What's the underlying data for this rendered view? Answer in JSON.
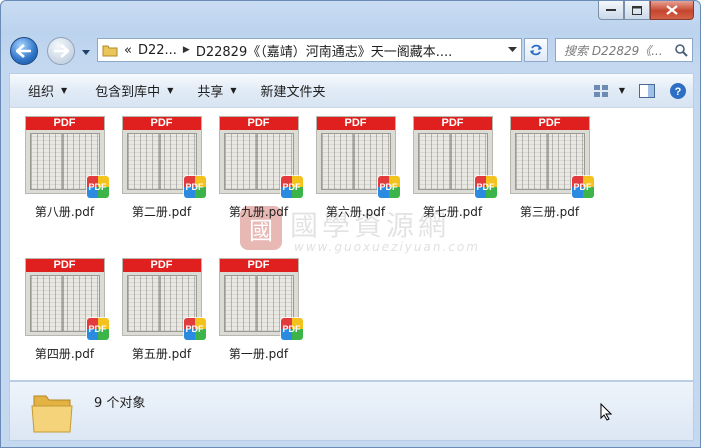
{
  "window": {
    "address_prefix": "«",
    "breadcrumb_1": "D22...",
    "breadcrumb_2": "D22829《（嘉靖）河南通志》天一阁藏本....",
    "search_placeholder": "搜索 D22829《..."
  },
  "toolbar": {
    "organize": "组织",
    "include_in_library": "包含到库中",
    "share": "共享",
    "new_folder": "新建文件夹"
  },
  "files": [
    {
      "name": "第八册.pdf",
      "band": "PDF",
      "badge": "PDF"
    },
    {
      "name": "第二册.pdf",
      "band": "PDF",
      "badge": "PDF"
    },
    {
      "name": "第九册.pdf",
      "band": "PDF",
      "badge": "PDF"
    },
    {
      "name": "第六册.pdf",
      "band": "PDF",
      "badge": "PDF"
    },
    {
      "name": "第七册.pdf",
      "band": "PDF",
      "badge": "PDF"
    },
    {
      "name": "第三册.pdf",
      "band": "PDF",
      "badge": "PDF"
    },
    {
      "name": "第四册.pdf",
      "band": "PDF",
      "badge": "PDF"
    },
    {
      "name": "第五册.pdf",
      "band": "PDF",
      "badge": "PDF"
    },
    {
      "name": "第一册.pdf",
      "band": "PDF",
      "badge": "PDF"
    }
  ],
  "watermark": {
    "seal": "國",
    "title": "國學資源網",
    "url": "www.guoxueziyuan.com"
  },
  "status": {
    "item_count": "9 个对象"
  },
  "colors": {
    "pdf_band": "#e0201f",
    "window_frame": "#bcd3ee",
    "close_button": "#c5452d"
  }
}
